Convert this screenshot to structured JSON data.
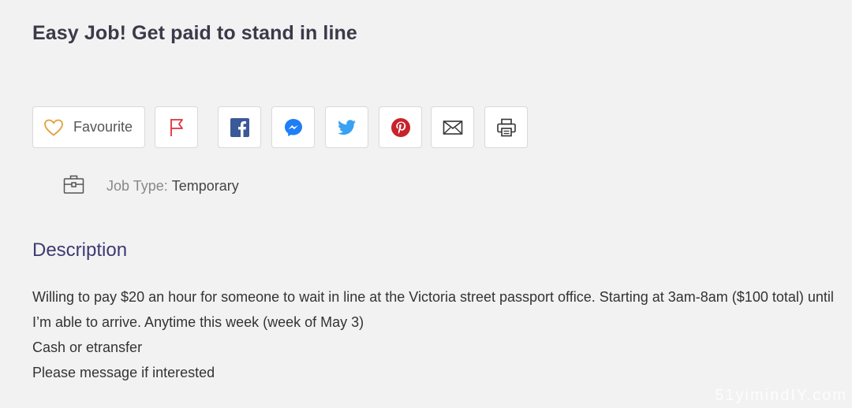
{
  "job": {
    "title": "Easy Job! Get paid to stand in line",
    "favourite_label": "Favourite",
    "job_type_label": "Job Type:",
    "job_type_value": "Temporary"
  },
  "share_buttons": [
    {
      "name": "flag",
      "icon": "flag-icon",
      "color": "#e0303a"
    },
    {
      "name": "facebook",
      "icon": "facebook-icon",
      "color": "#3b5998"
    },
    {
      "name": "messenger",
      "icon": "messenger-icon",
      "color": "#1f7ef5"
    },
    {
      "name": "twitter",
      "icon": "twitter-icon",
      "color": "#38a1f3"
    },
    {
      "name": "pinterest",
      "icon": "pinterest-icon",
      "color": "#c8232c"
    },
    {
      "name": "email",
      "icon": "envelope-icon",
      "color": "#333333"
    },
    {
      "name": "print",
      "icon": "printer-icon",
      "color": "#333333"
    }
  ],
  "description": {
    "heading": "Description",
    "lines": [
      "Willing to pay $20 an hour for someone to wait in line at the Victoria street passport office. Starting at 3am-8am ($100 total) until I’m able to arrive. Anytime this week (week of May 3)",
      "Cash or etransfer",
      "Please message if interested"
    ]
  },
  "watermark": "51yimindIY.com",
  "colors": {
    "heading_accent": "#3d3a73",
    "favourite_heart": "#e0a13a"
  }
}
